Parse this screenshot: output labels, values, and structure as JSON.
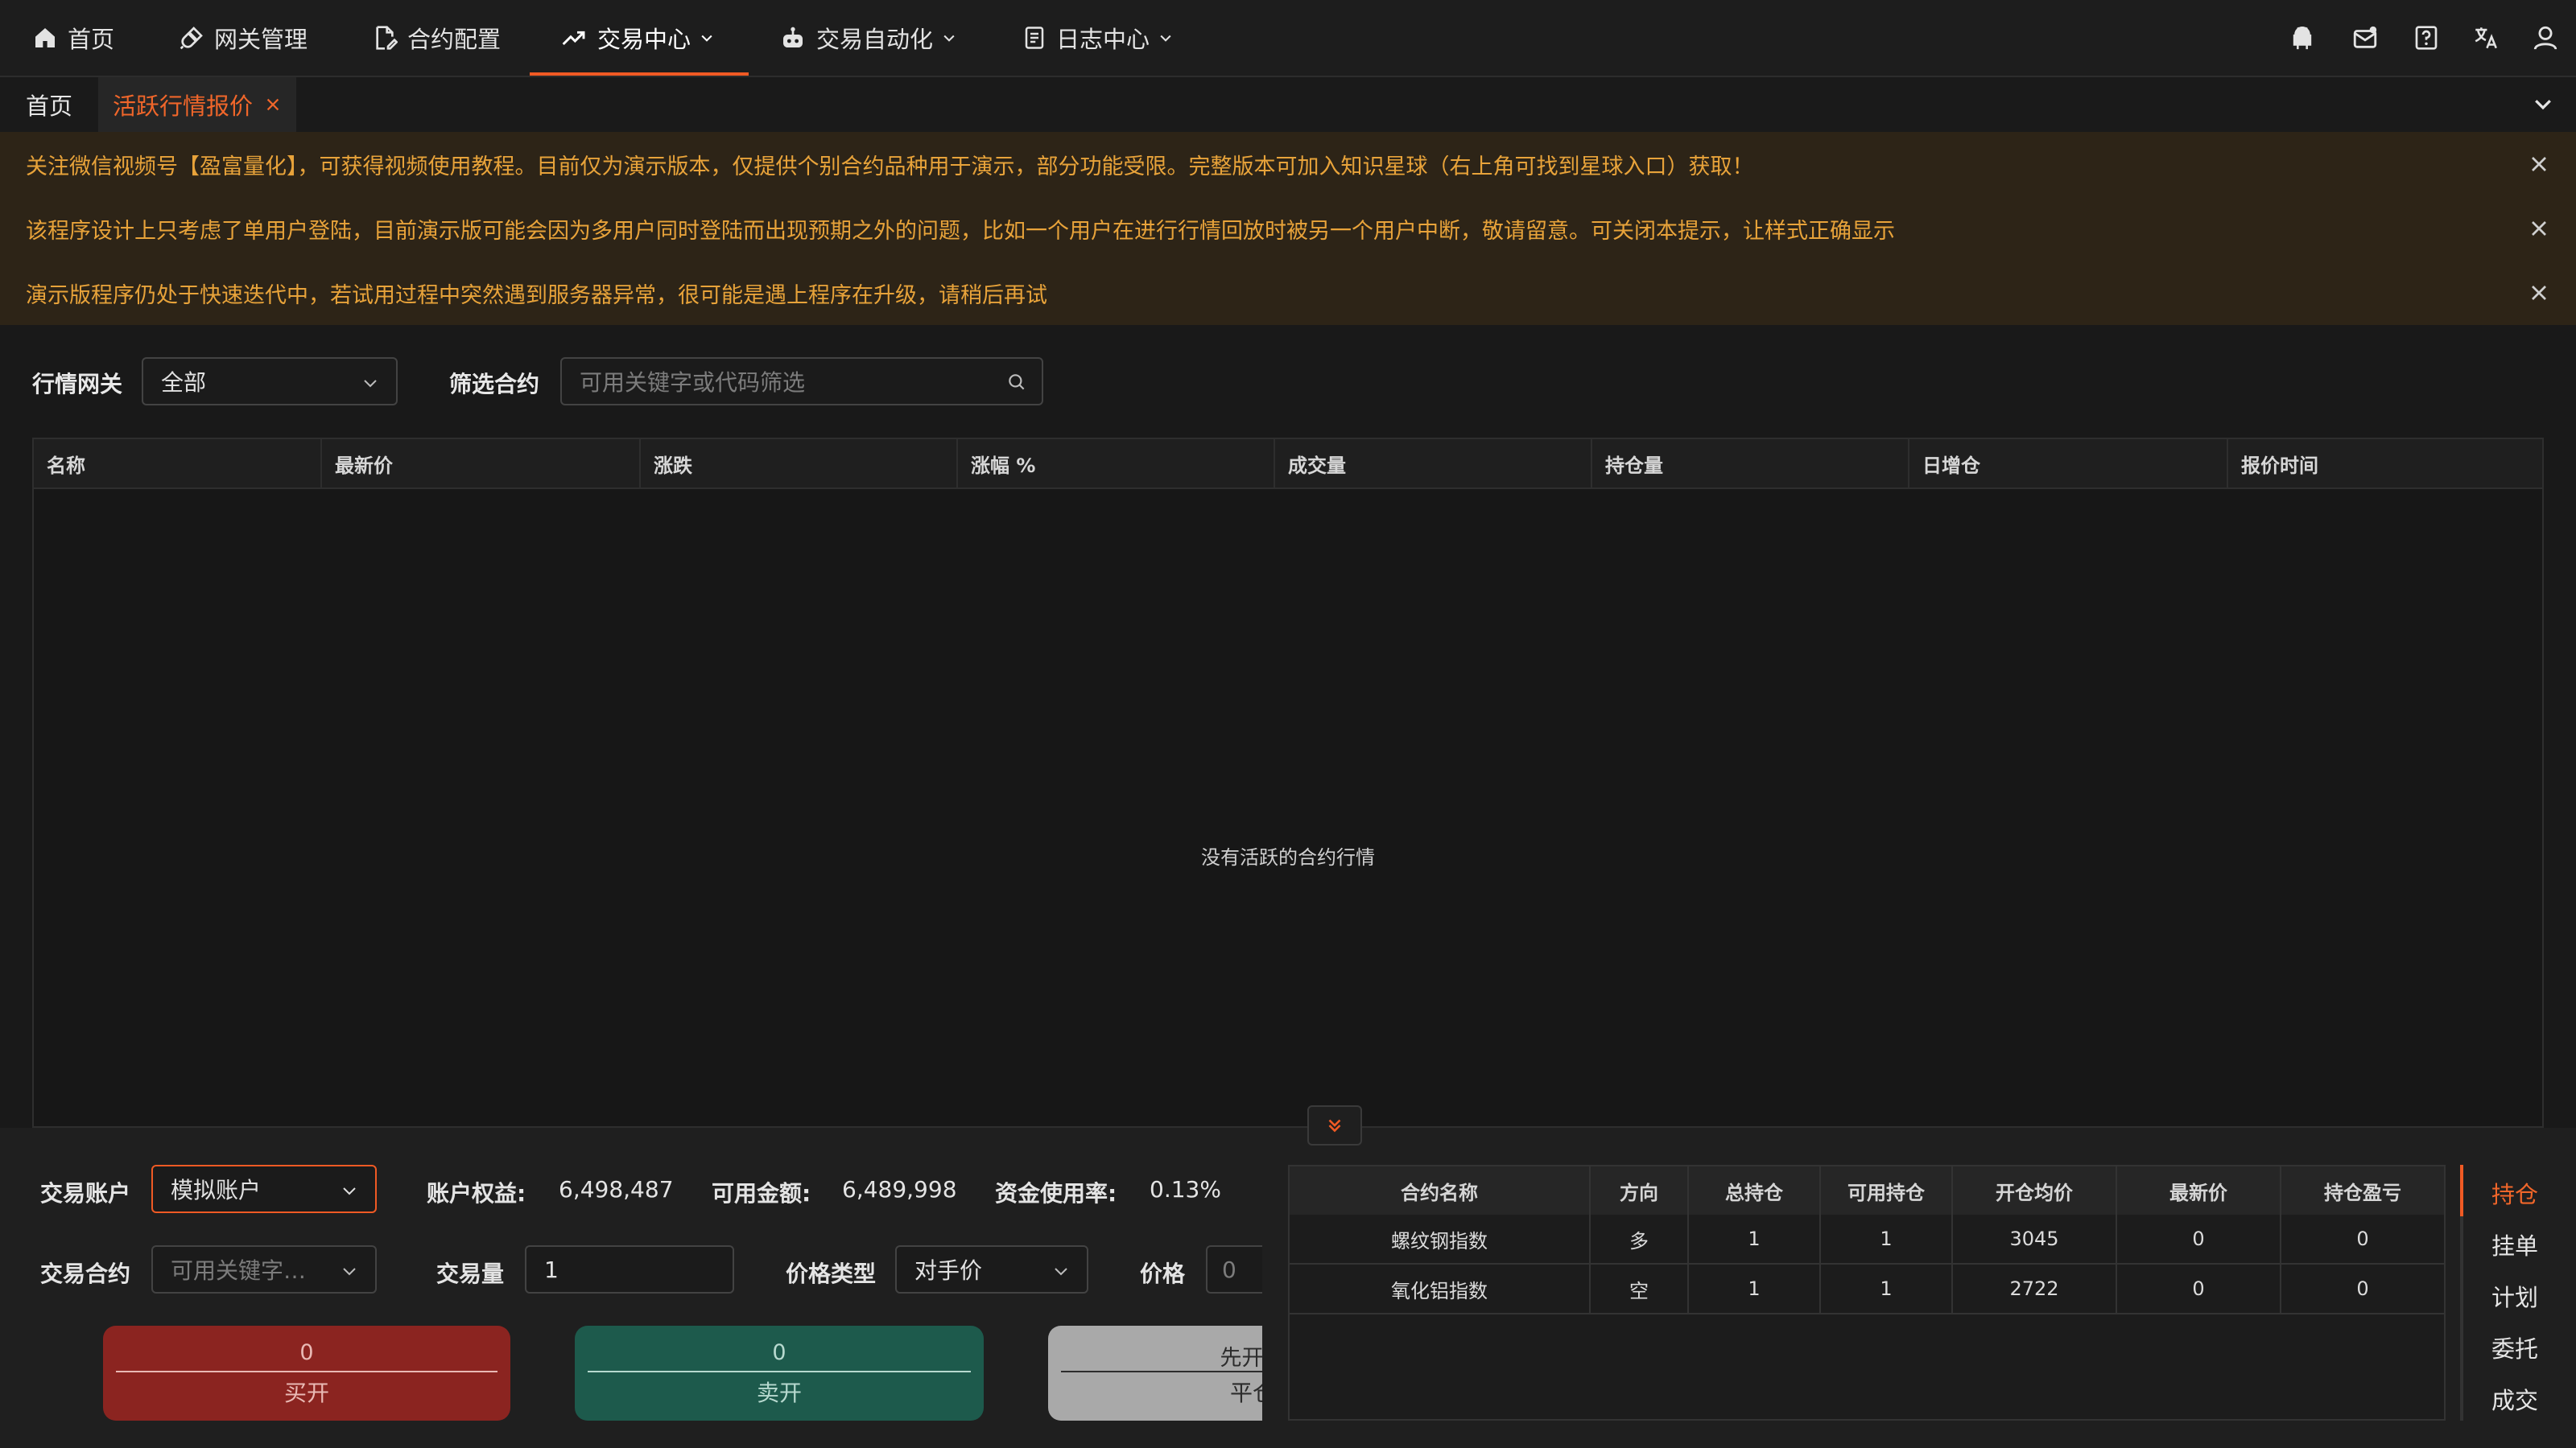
{
  "nav": {
    "items": [
      {
        "label": "首页",
        "icon": "home-icon"
      },
      {
        "label": "网关管理",
        "icon": "plug-icon"
      },
      {
        "label": "合约配置",
        "icon": "doc-edit-icon"
      },
      {
        "label": "交易中心",
        "icon": "trend-icon"
      },
      {
        "label": "交易自动化",
        "icon": "robot-icon"
      },
      {
        "label": "日志中心",
        "icon": "log-icon"
      }
    ],
    "active_index": 3
  },
  "tabs": {
    "home_label": "首页",
    "active_label": "活跃行情报价"
  },
  "notices": [
    "关注微信视频号【盈富量化】，可获得视频使用教程。目前仅为演示版本，仅提供个别合约品种用于演示，部分功能受限。完整版本可加入知识星球（右上角可找到星球入口）获取！",
    "该程序设计上只考虑了单用户登陆，目前演示版可能会因为多用户同时登陆而出现预期之外的问题，比如一个用户在进行行情回放时被另一个用户中断，敬请留意。可关闭本提示，让样式正确显示",
    "演示版程序仍处于快速迭代中，若试用过程中突然遇到服务器异常，很可能是遇上程序在升级，请稍后再试"
  ],
  "filters": {
    "gateway_label": "行情网关",
    "gateway_value": "全部",
    "contract_label": "筛选合约",
    "contract_placeholder": "可用关键字或代码筛选"
  },
  "market_table": {
    "columns": [
      "名称",
      "最新价",
      "涨跌",
      "涨幅 %",
      "成交量",
      "持仓量",
      "日增仓",
      "报价时间"
    ],
    "empty_text": "没有活跃的合约行情"
  },
  "trade": {
    "account_label": "交易账户",
    "account_value": "模拟账户",
    "equity_label": "账户权益:",
    "equity_value": "6,498,487",
    "available_label": "可用金额:",
    "available_value": "6,489,998",
    "usage_label": "资金使用率:",
    "usage_value": "0.13%",
    "contract_label": "交易合约",
    "contract_placeholder": "可用关键字…",
    "volume_label": "交易量",
    "volume_value": "1",
    "price_type_label": "价格类型",
    "price_type_value": "对手价",
    "price_label": "价格",
    "price_value": "0",
    "buy_price": "0",
    "buy_label": "买开",
    "sell_price": "0",
    "sell_label": "卖开",
    "close_top": "先开先",
    "close_label": "平仓"
  },
  "positions": {
    "columns": [
      "合约名称",
      "方向",
      "总持仓",
      "可用持仓",
      "开仓均价",
      "最新价",
      "持仓盈亏"
    ],
    "rows": [
      [
        "螺纹钢指数",
        "多",
        "1",
        "1",
        "3045",
        "0",
        "0"
      ],
      [
        "氧化铝指数",
        "空",
        "1",
        "1",
        "2722",
        "0",
        "0"
      ]
    ]
  },
  "side_tabs": [
    "持仓",
    "挂单",
    "计划",
    "委托",
    "成交"
  ],
  "colors": {
    "accent": "#f05a24",
    "buy": "#8b2420",
    "sell": "#1d5a4c",
    "notice_text": "#e8a33a",
    "notice_bg": "#2d2417"
  }
}
